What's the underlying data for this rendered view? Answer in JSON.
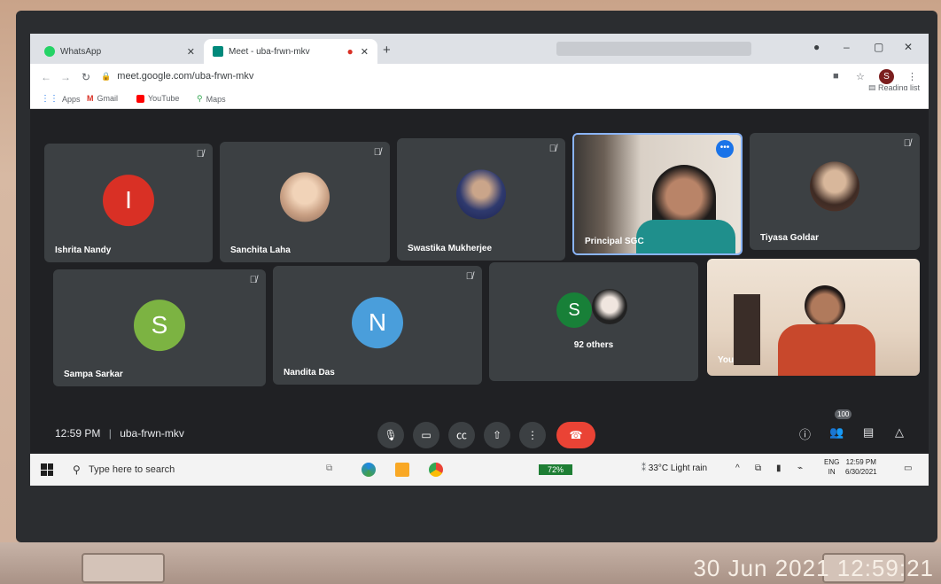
{
  "browser": {
    "tabs": [
      {
        "label": "WhatsApp",
        "icon": "whatsapp-icon",
        "color": "#25d366"
      },
      {
        "label": "Meet - uba-frwn-mkv",
        "icon": "meet-icon",
        "color": "#00897b"
      }
    ],
    "url": "meet.google.com/uba-frwn-mkv",
    "bookmarks": [
      "Apps",
      "Gmail",
      "YouTube",
      "Maps"
    ],
    "reading_list": "Reading list",
    "profile_initial": "S"
  },
  "participants": [
    {
      "name": "Ishrita Nandy",
      "initial": "I",
      "color": "#d93025"
    },
    {
      "name": "Sanchita Laha",
      "initial": "",
      "color": ""
    },
    {
      "name": "Swastika Mukherjee",
      "initial": "",
      "color": ""
    },
    {
      "name": "Principal SGC",
      "initial": "",
      "color": ""
    },
    {
      "name": "Tiyasa Goldar",
      "initial": "",
      "color": ""
    },
    {
      "name": "Sampa Sarkar",
      "initial": "S",
      "color": "#7cb342"
    },
    {
      "name": "Nandita Das",
      "initial": "N",
      "color": "#4a9edb"
    },
    {
      "name": "92 others",
      "initial": "S",
      "color": "#188038"
    },
    {
      "name": "You",
      "initial": "",
      "color": ""
    }
  ],
  "meeting": {
    "time": "12:59 PM",
    "separator": "|",
    "code": "uba-frwn-mkv",
    "participant_count": "100"
  },
  "taskbar": {
    "search_placeholder": "Type here to search",
    "battery": "72%",
    "weather": "33°C  Light rain",
    "lang_top": "ENG",
    "lang_bottom": "IN",
    "clock_time": "12:59 PM",
    "clock_date": "6/30/2021"
  },
  "photo_stamp": "30 Jun 2021 12:59:21"
}
